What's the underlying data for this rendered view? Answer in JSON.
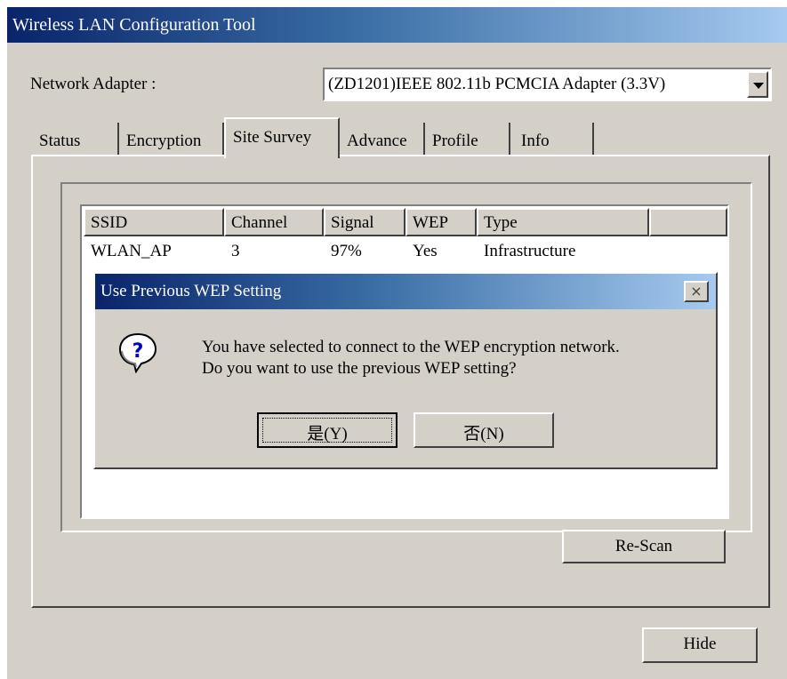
{
  "window": {
    "title": "Wireless LAN Configuration Tool"
  },
  "adapter": {
    "label": "Network Adapter :",
    "selected": "(ZD1201)IEEE 802.11b PCMCIA Adapter (3.3V)"
  },
  "tabs": [
    {
      "label": "Status"
    },
    {
      "label": "Encryption"
    },
    {
      "label": "Site Survey",
      "active": true
    },
    {
      "label": "Advance"
    },
    {
      "label": "Profile"
    },
    {
      "label": "Info"
    }
  ],
  "site_survey": {
    "columns": [
      "SSID",
      "Channel",
      "Signal",
      "WEP",
      "Type"
    ],
    "rows": [
      {
        "ssid": "WLAN_AP",
        "channel": "3",
        "signal": "97%",
        "wep": "Yes",
        "type": "Infrastructure"
      }
    ],
    "rescan_label": "Re-Scan"
  },
  "hide_label": "Hide",
  "dialog": {
    "title": "Use Previous WEP Setting",
    "close_glyph": "×",
    "message_line1": "You have selected to connect to the WEP encryption network.",
    "message_line2": "Do you want to use the previous WEP setting?",
    "yes_label": "是(Y)",
    "no_label": "否(N)",
    "icon": "question-icon"
  },
  "colors": {
    "title_gradient_start": "#0a246a",
    "title_gradient_end": "#a6caf0",
    "face": "#d4d0c8"
  }
}
